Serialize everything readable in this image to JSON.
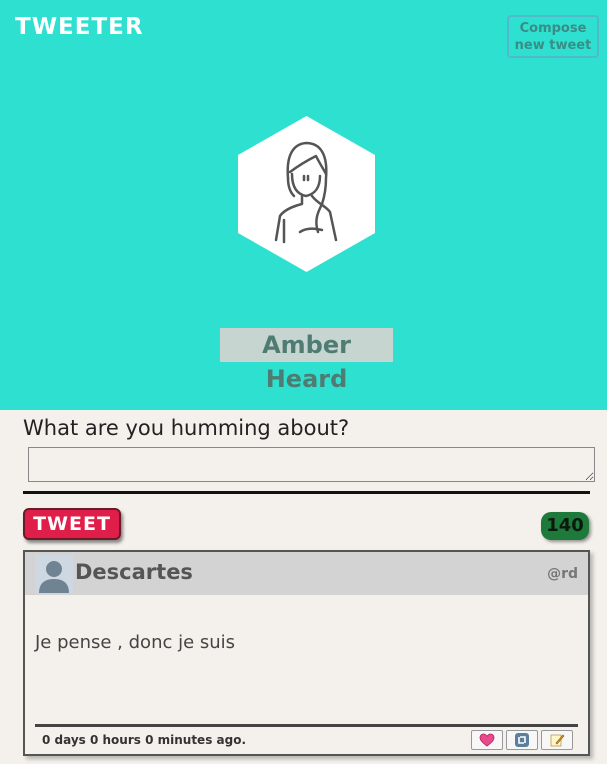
{
  "header": {
    "brand": "TWEETER",
    "compose_button": "Compose new tweet"
  },
  "profile": {
    "name": "Amber Heard",
    "avatar_icon": "woman-portrait-icon"
  },
  "composer": {
    "prompt": "What are you humming about?",
    "input_value": "",
    "submit_label": "TWEET",
    "char_counter": "140"
  },
  "tweets": [
    {
      "author": "Descartes",
      "handle": "@rd",
      "text": "Je pense , donc je suis",
      "timestamp": "0 days 0 hours 0 minutes ago.",
      "actions": [
        "heart-icon",
        "retweet-icon",
        "edit-icon"
      ]
    }
  ],
  "colors": {
    "hero": "#2ee0cf",
    "tweet_button": "#e01e4a",
    "counter": "#1d7a3a",
    "background": "#f4f1ec"
  }
}
